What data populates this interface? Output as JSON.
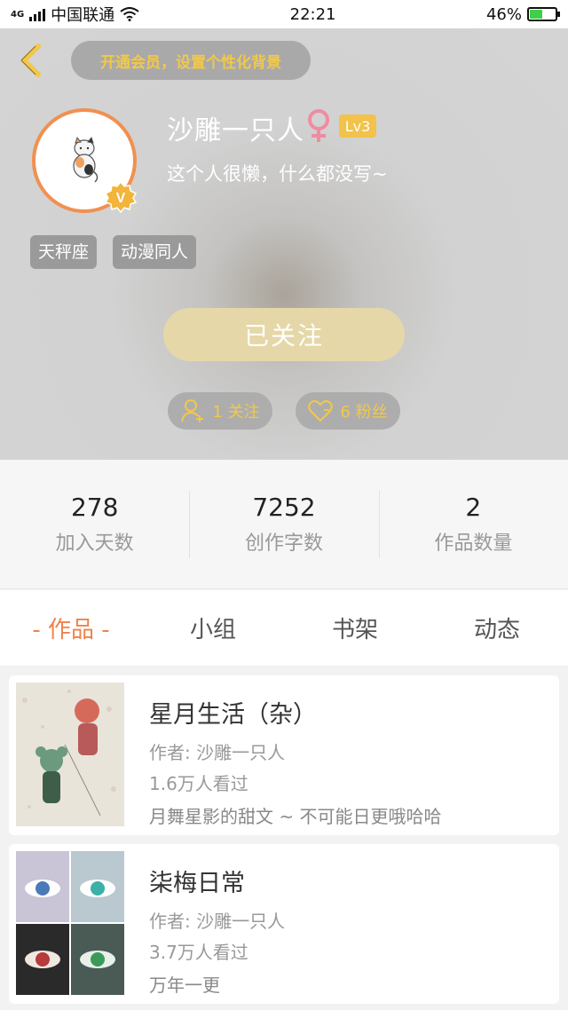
{
  "status_bar": {
    "network": "4G",
    "carrier": "中国联通",
    "time": "22:21",
    "battery": "46%",
    "battery_level": 0.46
  },
  "header": {
    "vip_prompt": "开通会员，设置个性化背景",
    "username": "沙雕一只人",
    "gender_icon": "female-icon",
    "level": "Lv3",
    "bio": "这个人很懒，什么都没写~",
    "tags": [
      "天秤座",
      "动漫同人"
    ],
    "follow_button": "已关注",
    "following": "1 关注",
    "fans": "6 粉丝"
  },
  "stats": [
    {
      "value": "278",
      "label": "加入天数"
    },
    {
      "value": "7252",
      "label": "创作字数"
    },
    {
      "value": "2",
      "label": "作品数量"
    }
  ],
  "tabs": [
    {
      "label": "- 作品 -",
      "active": true
    },
    {
      "label": "小组",
      "active": false
    },
    {
      "label": "书架",
      "active": false
    },
    {
      "label": "动态",
      "active": false
    }
  ],
  "works": [
    {
      "title": "星月生活（杂）",
      "author": "作者: 沙雕一只人",
      "views": "1.6万人看过",
      "desc": "月舞星影的甜文 ~ 不可能日更哦哈哈"
    },
    {
      "title": "柒梅日常",
      "author": "作者: 沙雕一只人",
      "views": "3.7万人看过",
      "desc": "万年一更"
    }
  ],
  "colors": {
    "accent": "#f0824a",
    "gold": "#f2c84a",
    "avatar_ring": "#f19050"
  }
}
